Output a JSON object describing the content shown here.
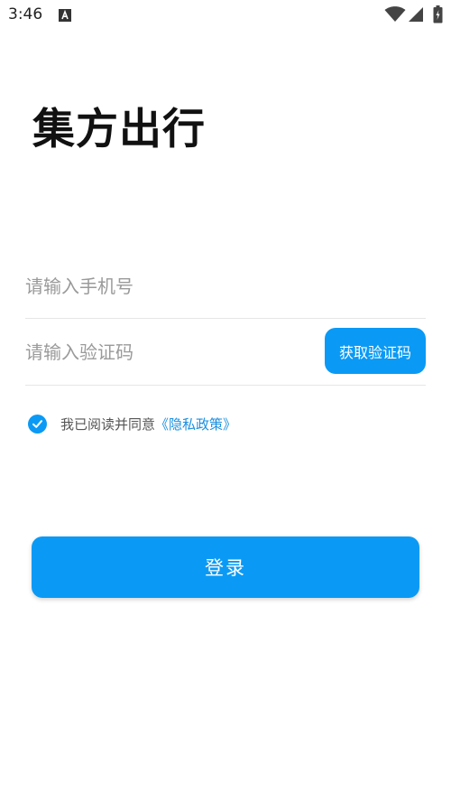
{
  "status_bar": {
    "time": "3:46",
    "icons": [
      "a-notification-icon",
      "wifi-icon",
      "signal-icon",
      "battery-icon"
    ]
  },
  "app": {
    "title": "集方出行"
  },
  "form": {
    "phone": {
      "placeholder": "请输入手机号",
      "value": ""
    },
    "code": {
      "placeholder": "请输入验证码",
      "value": "",
      "get_code_label": "获取验证码"
    },
    "agreement": {
      "checked": true,
      "text": "我已阅读并同意",
      "policy_link": "《隐私政策》"
    },
    "login_label": "登录"
  },
  "colors": {
    "accent": "#0a9af5",
    "link": "#1a8fe0",
    "placeholder": "#9a9a9a",
    "divider": "#e6e6e6"
  }
}
